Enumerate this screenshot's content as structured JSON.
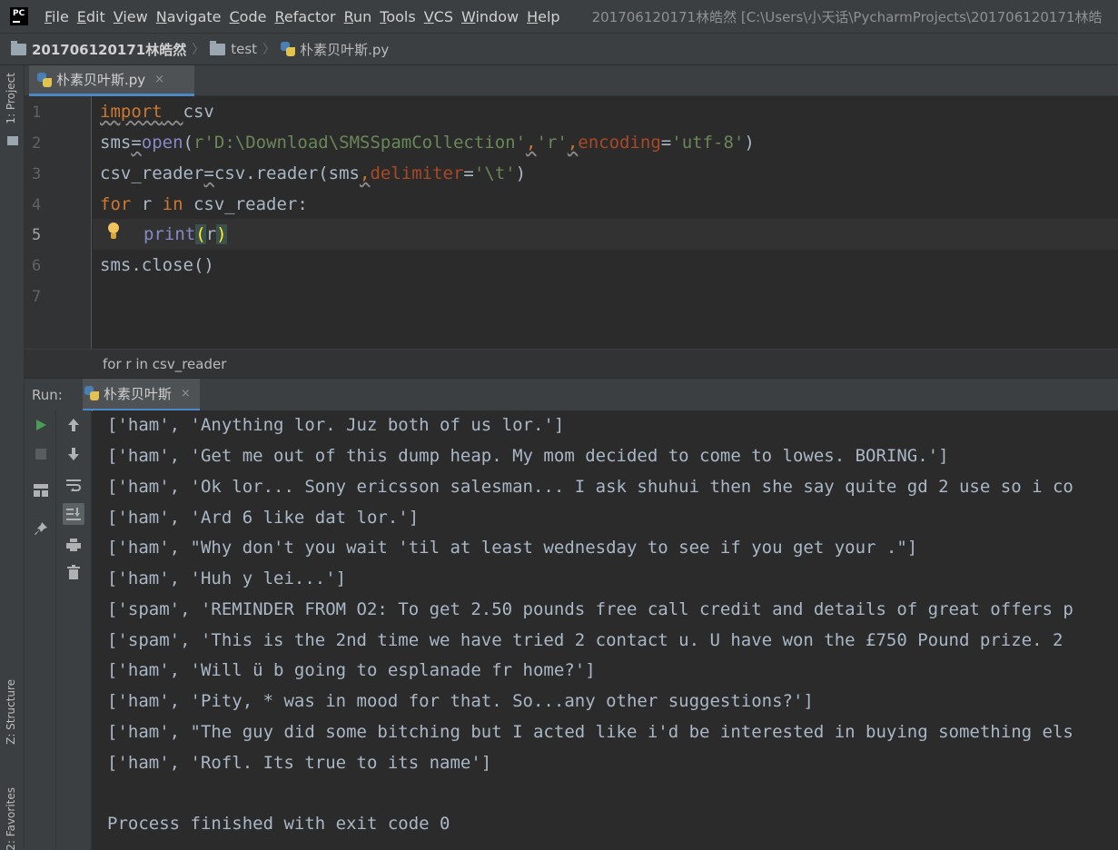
{
  "menubar": {
    "logo_text": "PC",
    "items": [
      {
        "mnemonic": "F",
        "rest": "ile"
      },
      {
        "mnemonic": "E",
        "rest": "dit"
      },
      {
        "mnemonic": "V",
        "rest": "iew"
      },
      {
        "mnemonic": "N",
        "rest": "avigate"
      },
      {
        "mnemonic": "C",
        "rest": "ode"
      },
      {
        "mnemonic": "R",
        "rest": "efactor"
      },
      {
        "mnemonic": "R",
        "rest": "un"
      },
      {
        "mnemonic": "T",
        "rest": "ools"
      },
      {
        "mnemonic": "V",
        "rest": "CS"
      },
      {
        "mnemonic": "W",
        "rest": "indow"
      },
      {
        "mnemonic": "H",
        "rest": "elp"
      }
    ],
    "window_title": "201706120171林皓然 [C:\\Users\\小天话\\PycharmProjects\\201706120171林皓"
  },
  "navbar": {
    "project": "201706120171林皓然",
    "folder": "test",
    "file": "朴素贝叶斯.py",
    "separator": "〉"
  },
  "left_strip": {
    "project": "1: Project",
    "structure": "Z: Structure",
    "favorites": "2: Favorites"
  },
  "editor_tab": {
    "label": "朴素贝叶斯.py",
    "close": "×"
  },
  "editor": {
    "line_numbers": [
      "1",
      "2",
      "3",
      "4",
      "5",
      "6",
      "7"
    ],
    "active_line": "5",
    "code": {
      "l1_kw": "import",
      "l1_rest": "csv",
      "l2_sms": "sms",
      "l2_eq": "=",
      "l2_open": "open",
      "l2_paren": "(",
      "l2_str": "r'D:\\Download\\SMSSpamCollection'",
      "l2_comma1": ",",
      "l2_mode": "'r'",
      "l2_comma2": ",",
      "l2_param": "encoding",
      "l2_eq2": "=",
      "l2_enc": "'utf-8'",
      "l2_close": ")",
      "l3_var": "csv_reader",
      "l3_eq": "=",
      "l3_call": "csv.reader(sms",
      "l3_comma": ",",
      "l3_param": "delimiter",
      "l3_eq2": "=",
      "l3_str": "'\\t'",
      "l3_close": ")",
      "l4_for": "for",
      "l4_mid": " r ",
      "l4_in": "in",
      "l4_rest": " csv_reader:",
      "l5_fn": "print",
      "l5_open": "(",
      "l5_arg": "r",
      "l5_close": ")",
      "l6": "sms.close()"
    }
  },
  "breadcrumb": "for r in csv_reader",
  "run": {
    "label": "Run:",
    "tab": "朴素贝叶斯",
    "close": "×",
    "output": [
      "['ham', 'Anything lor. Juz both of us lor.']",
      "['ham', 'Get me out of this dump heap. My mom decided to come to lowes. BORING.']",
      "['ham', 'Ok lor... Sony ericsson salesman... I ask shuhui then she say quite gd 2 use so i co",
      "['ham', 'Ard 6 like dat lor.']",
      "['ham', \"Why don't you wait 'til at least wednesday to see if you get your .\"]",
      "['ham', 'Huh y lei...']",
      "['spam', 'REMINDER FROM O2: To get 2.50 pounds free call credit and details of great offers p",
      "['spam', 'This is the 2nd time we have tried 2 contact u. U have won the £750 Pound prize. 2 ",
      "['ham', 'Will ü b going to esplanade fr home?']",
      "['ham', 'Pity, * was in mood for that. So...any other suggestions?']",
      "['ham', \"The guy did some bitching but I acted like i'd be interested in buying something els",
      "['ham', 'Rofl. Its true to its name']",
      "",
      "Process finished with exit code 0"
    ]
  },
  "colors": {
    "keyword": "#cc7832",
    "builtin": "#8888c6",
    "string": "#6a8759",
    "param": "#aa4926",
    "text": "#a9b7c6",
    "run_green": "#499c54"
  }
}
